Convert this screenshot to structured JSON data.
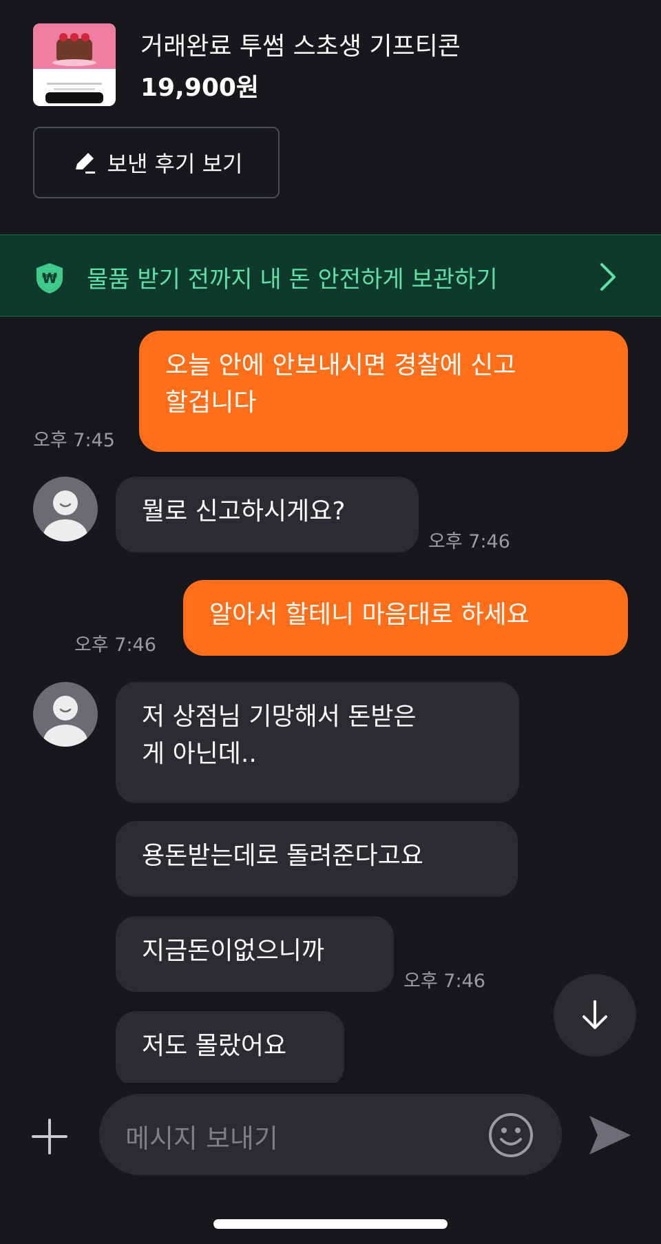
{
  "product": {
    "thumbnail_icon": "cake-gifticon-thumbnail",
    "title": "거래완료 투썸 스초생 기프티콘",
    "price": "19,900원",
    "review_button_label": "보낸 후기 보기"
  },
  "banner": {
    "text": "물품 받기 전까지 내 돈 안전하게 보관하기",
    "icon": "won-shield-icon"
  },
  "messages": [
    {
      "dir": "out",
      "text": "오늘 안에 안보내시면 경찰에 신고\n할겁니다",
      "time": "오후 7:45"
    },
    {
      "dir": "in",
      "text": "뭘로 신고하시게요?",
      "time": "오후 7:46"
    },
    {
      "dir": "out",
      "text": "알아서 할테니 마음대로 하세요",
      "time": "오후 7:46"
    },
    {
      "dir": "in",
      "text": "저 상점님 기망해서 돈받은\n게 아닌데..",
      "time": ""
    },
    {
      "dir": "in",
      "text": "용돈받는데로 돌려준다고요",
      "time": ""
    },
    {
      "dir": "in",
      "text": "지금돈이없으니까",
      "time": "오후 7:46"
    },
    {
      "dir": "in",
      "text": "저도 몰랐어요",
      "time": ""
    }
  ],
  "composer": {
    "placeholder": "메시지 보내기"
  },
  "colors": {
    "background": "#17181c",
    "outgoing_bubble": "#ff6f1a",
    "incoming_bubble": "#2b2c31",
    "banner_bg": "#0d3a2b",
    "banner_text": "#5fe0a6"
  }
}
